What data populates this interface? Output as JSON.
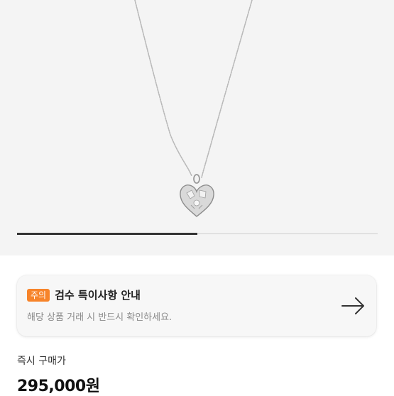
{
  "product": {
    "image_name": "heart-pendant-necklace",
    "gallery_progress": 0.5
  },
  "notice": {
    "badge": "주의",
    "title": "검수 특이사항 안내",
    "subtitle": "해당 상품 거래 시 반드시 확인하세요.",
    "badge_color": "#f7842a",
    "arrow_icon": "arrow-right-icon"
  },
  "price": {
    "label": "즉시 구매가",
    "value": "295,000원"
  }
}
